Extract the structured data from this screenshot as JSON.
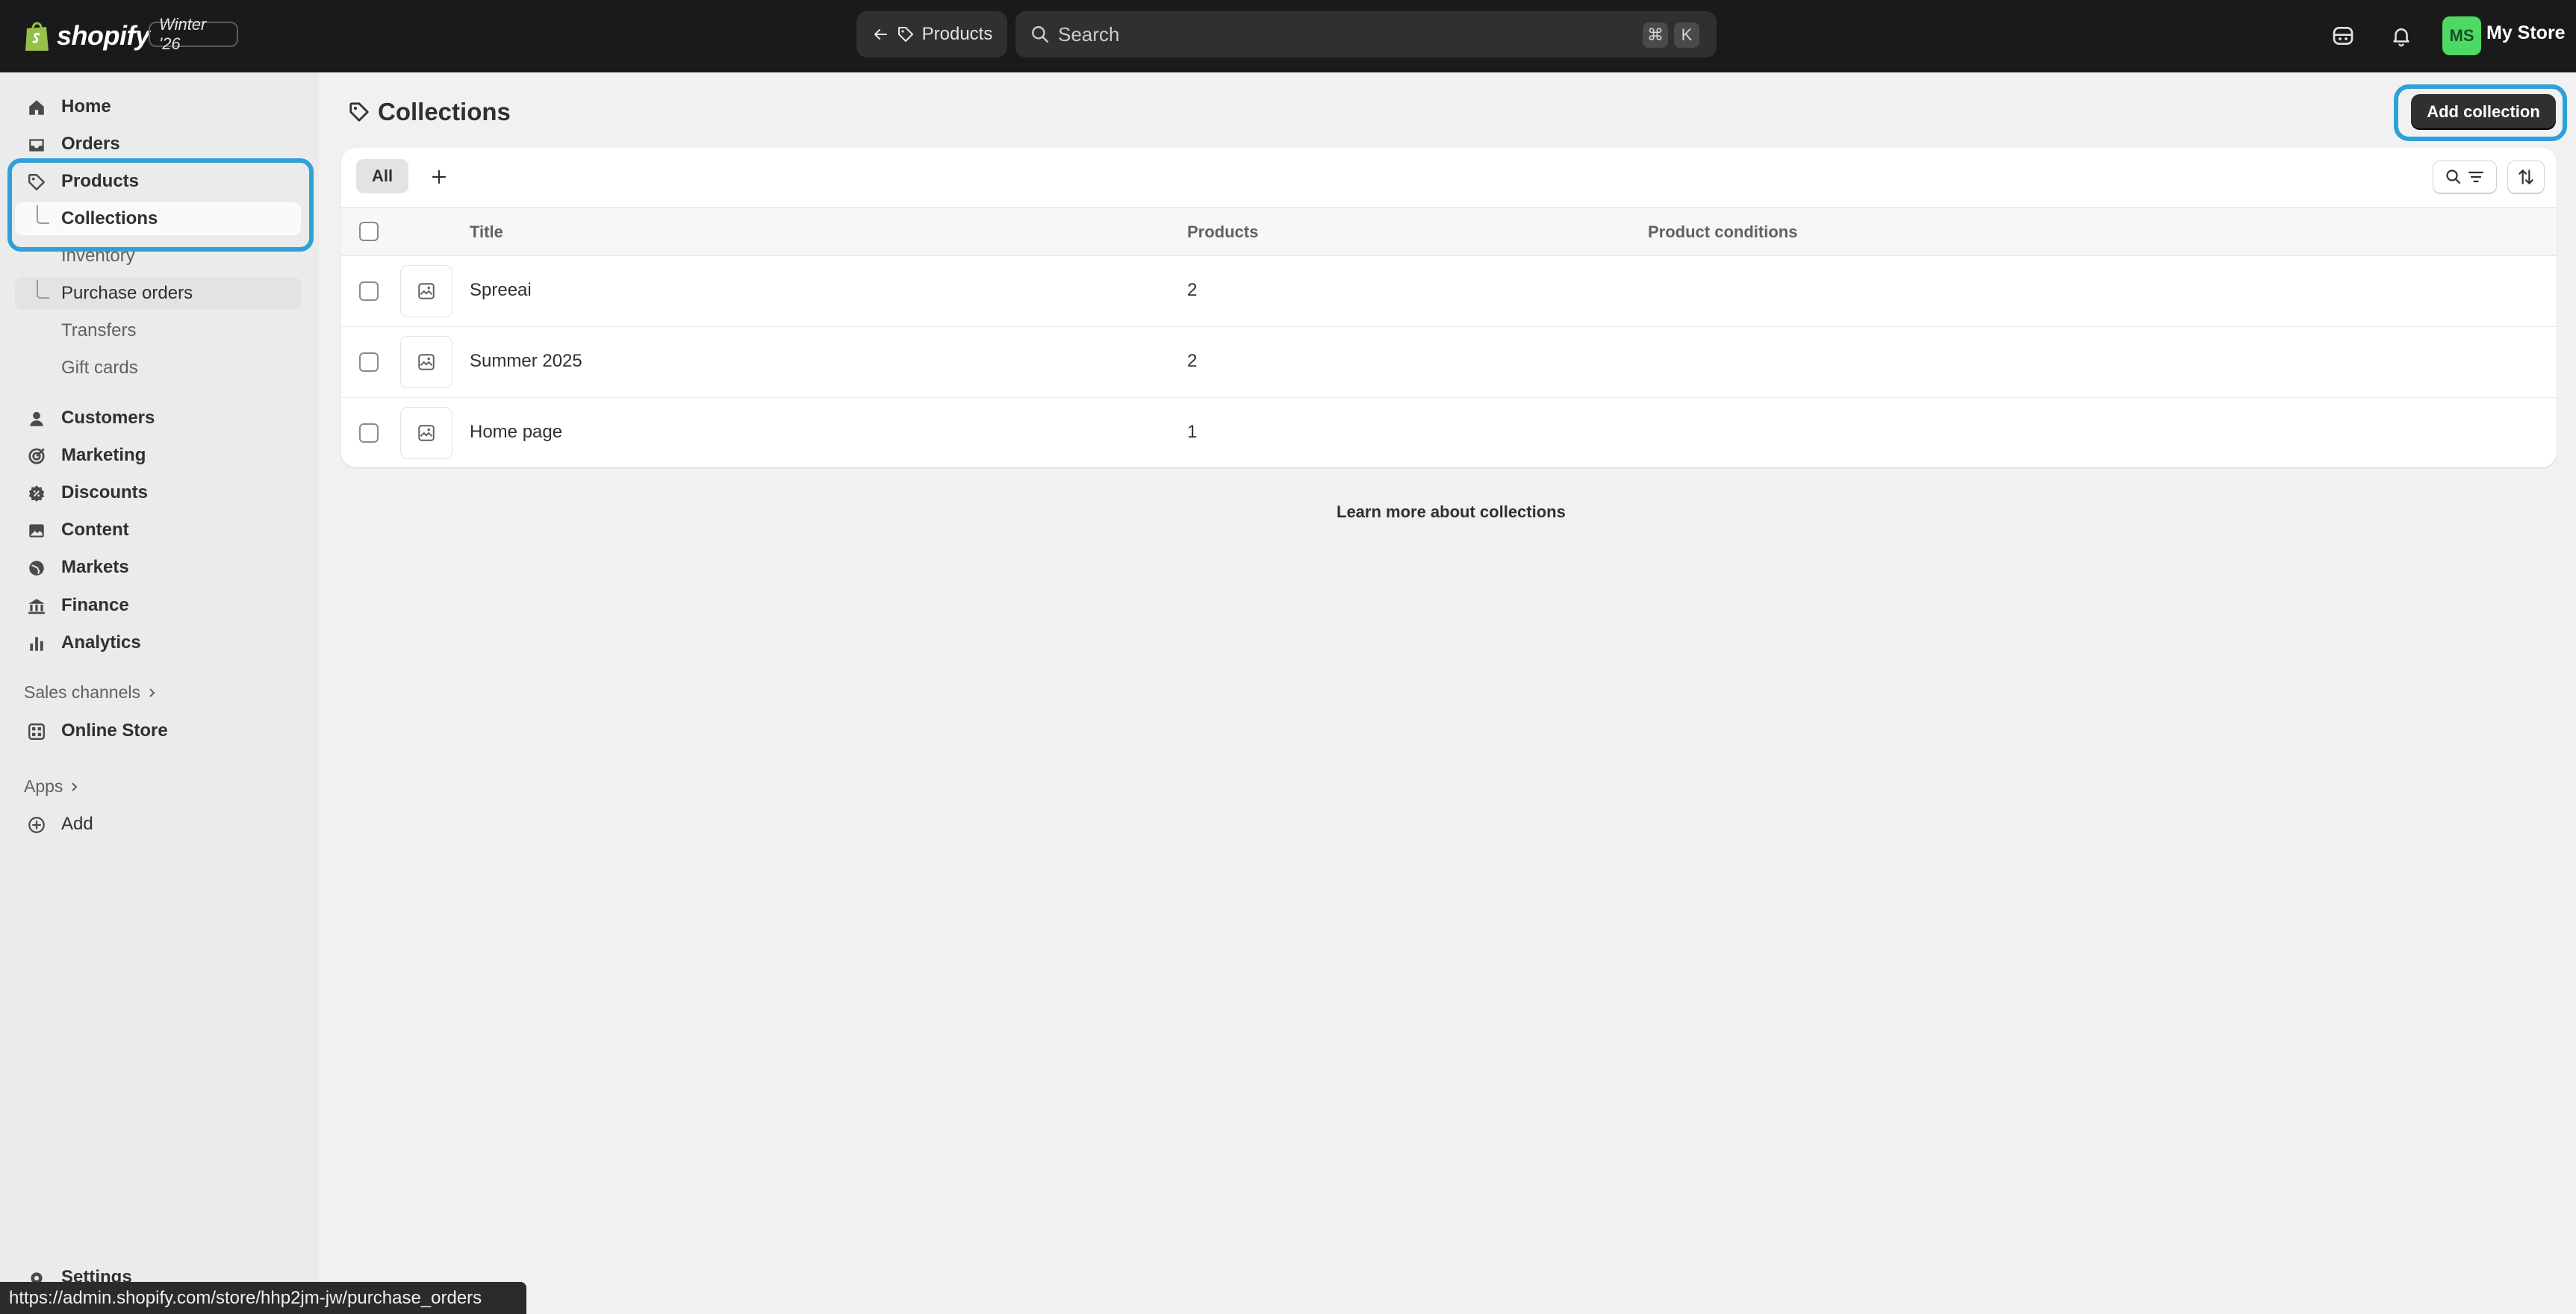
{
  "topbar": {
    "brand": "shopify",
    "edition": "Winter '26",
    "back_label": "Products",
    "search_placeholder": "Search",
    "shortcut_mod": "⌘",
    "shortcut_key": "K",
    "avatar_initials": "MS",
    "store_name": "My Store"
  },
  "sidebar": {
    "home": "Home",
    "orders": "Orders",
    "products": "Products",
    "collections": "Collections",
    "inventory": "Inventory",
    "purchase_orders": "Purchase orders",
    "transfers": "Transfers",
    "gift_cards": "Gift cards",
    "customers": "Customers",
    "marketing": "Marketing",
    "discounts": "Discounts",
    "content": "Content",
    "markets": "Markets",
    "finance": "Finance",
    "analytics": "Analytics",
    "sales_channels": "Sales channels",
    "online_store": "Online Store",
    "apps": "Apps",
    "add": "Add",
    "settings": "Settings"
  },
  "main": {
    "title": "Collections",
    "add_button": "Add collection",
    "tab_all": "All",
    "columns": {
      "title": "Title",
      "products": "Products",
      "conditions": "Product conditions"
    },
    "rows": [
      {
        "title": "Spreeai",
        "products": "2",
        "conditions": ""
      },
      {
        "title": "Summer 2025",
        "products": "2",
        "conditions": ""
      },
      {
        "title": "Home page",
        "products": "1",
        "conditions": ""
      }
    ],
    "learn_more": "Learn more about collections"
  },
  "status_bar": {
    "url": "https://admin.shopify.com/store/hhp2jm-jw/purchase_orders"
  },
  "colors": {
    "accent_highlight": "#2fa0d8",
    "topbar_bg": "#1a1a1a",
    "primary_button": "#303030",
    "avatar_bg": "#4cd964"
  }
}
